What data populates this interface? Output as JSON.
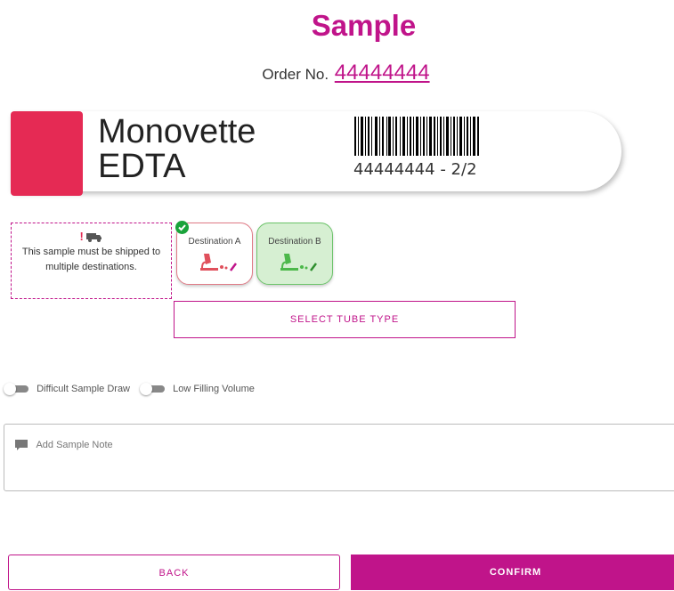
{
  "title": "Sample",
  "order": {
    "label": "Order No.",
    "number": "44444444"
  },
  "tube": {
    "name_line1": "Monovette",
    "name_line2": "EDTA",
    "cap_color": "#e52a54",
    "barcode_text": "44444444 - 2/2"
  },
  "shipping": {
    "warning_mark": "!",
    "message_line1": "This sample must be shipped to",
    "message_line2": "multiple destinations."
  },
  "destinations": [
    {
      "label": "Destination A",
      "status": "selected"
    },
    {
      "label": "Destination B",
      "status": "completed"
    }
  ],
  "select_tube_type_label": "SELECT TUBE TYPE",
  "toggles": [
    {
      "label": "Difficult Sample Draw",
      "on": false
    },
    {
      "label": "Low Filling Volume",
      "on": false
    }
  ],
  "note": {
    "placeholder": "Add Sample Note"
  },
  "buttons": {
    "back": "BACK",
    "confirm": "CONFIRM"
  },
  "colors": {
    "accent": "#c0148a",
    "cap": "#e52a54",
    "success": "#1aa33b"
  }
}
